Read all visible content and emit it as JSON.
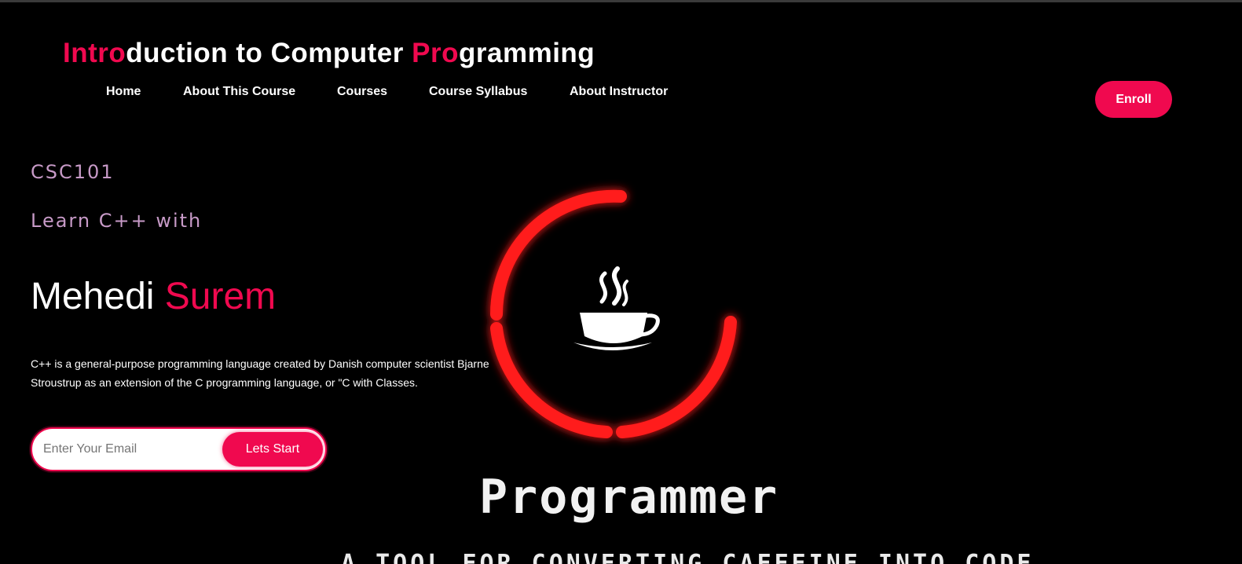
{
  "header": {
    "title_parts": [
      {
        "text": "Intro",
        "accent": true
      },
      {
        "text": "duction to Computer ",
        "accent": false
      },
      {
        "text": "Pro",
        "accent": true
      },
      {
        "text": "gramming",
        "accent": false
      }
    ],
    "nav": [
      {
        "label": "Home",
        "name": "nav-home"
      },
      {
        "label": "About This Course",
        "name": "nav-about-course"
      },
      {
        "label": "Courses",
        "name": "nav-courses"
      },
      {
        "label": "Course Syllabus",
        "name": "nav-course-syllabus"
      },
      {
        "label": "About Instructor",
        "name": "nav-about-instructor"
      }
    ],
    "enroll_label": "Enroll"
  },
  "hero": {
    "course_code": "CSC101",
    "learn_line": "Learn C++ with",
    "instructor_first": "Mehedi",
    "instructor_last": "Surem",
    "description": "C++ is a general-purpose programming language created by Danish computer scientist Bjarne Stroustrup as an extension of the C programming language, or \"C with Classes.",
    "email_placeholder": "Enter Your Email",
    "start_label": "Lets Start"
  },
  "graphic": {
    "word": "Programmer",
    "tagline": "A TOOL FOR CONVERTING CAFFEINE INTO CODE",
    "icon": "coffee-cup-icon"
  },
  "colors": {
    "accent": "#f0094f",
    "background": "#000000",
    "subtitle": "#c79ac7",
    "ring": "#ff1a1a"
  }
}
